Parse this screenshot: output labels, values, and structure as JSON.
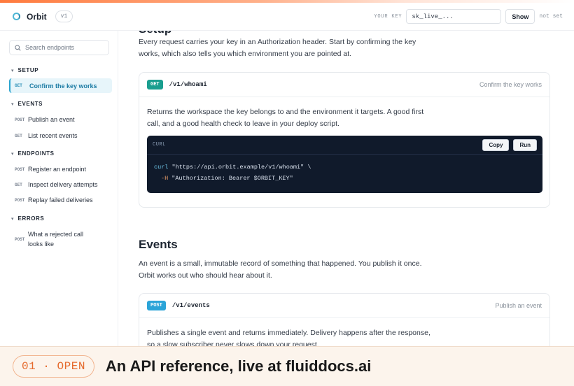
{
  "brand": {
    "name": "Orbit",
    "version": "v1"
  },
  "topbar": {
    "key_label": "YOUR KEY",
    "key_value": "sk_live_...",
    "show_label": "Show",
    "key_status": "not set"
  },
  "sidebar": {
    "search_placeholder": "Search endpoints",
    "sections": [
      {
        "title": "SETUP",
        "items": [
          {
            "method": "GET",
            "label": "Confirm the key works",
            "active": true
          }
        ]
      },
      {
        "title": "EVENTS",
        "items": [
          {
            "method": "POST",
            "label": "Publish an event"
          },
          {
            "method": "GET",
            "label": "List recent events"
          }
        ]
      },
      {
        "title": "ENDPOINTS",
        "items": [
          {
            "method": "POST",
            "label": "Register an endpoint"
          },
          {
            "method": "GET",
            "label": "Inspect delivery attempts"
          },
          {
            "method": "POST",
            "label": "Replay failed deliveries"
          }
        ]
      },
      {
        "title": "ERRORS",
        "items": [
          {
            "method": "POST",
            "label_line1": "What a rejected call",
            "label_line2": "looks like"
          }
        ]
      }
    ]
  },
  "main": {
    "setup_heading_cut": "Setup",
    "setup_intro_line1": "Every request carries your key in an Authorization header. Start by confirming the key",
    "setup_intro_line2": "works, which also tells you which environment you are pointed at.",
    "whoami_card": {
      "method": "GET",
      "method_color": "#1a9e8f",
      "path": "/v1/whoami",
      "title": "Confirm the key works",
      "desc_line1": "Returns the workspace the key belongs to and the environment it targets. A good first",
      "desc_line2": "call, and a good health check to leave in your deploy script.",
      "code": {
        "lang": "CURL",
        "copy_label": "Copy",
        "run_label": "Run",
        "line1_cmd": "curl",
        "line1_rest": " \"https://api.orbit.example/v1/whoami\" \\",
        "line2_flag": "-H",
        "line2_rest": " \"Authorization: Bearer $ORBIT_KEY\""
      }
    },
    "events_heading": "Events",
    "events_intro_line1": "An event is a small, immutable record of something that happened. You publish it once.",
    "events_intro_line2": "Orbit works out who should hear about it.",
    "events_card": {
      "method": "POST",
      "method_color": "#2ba4d8",
      "path": "/v1/events",
      "title": "Publish an event",
      "desc_line1": "Publishes a single event and returns immediately. Delivery happens after the response,",
      "desc_line2": "so a slow subscriber never slows down your request."
    }
  },
  "footer": {
    "chip": "01 · OPEN",
    "text": "An API reference, live at fluiddocs.ai"
  }
}
